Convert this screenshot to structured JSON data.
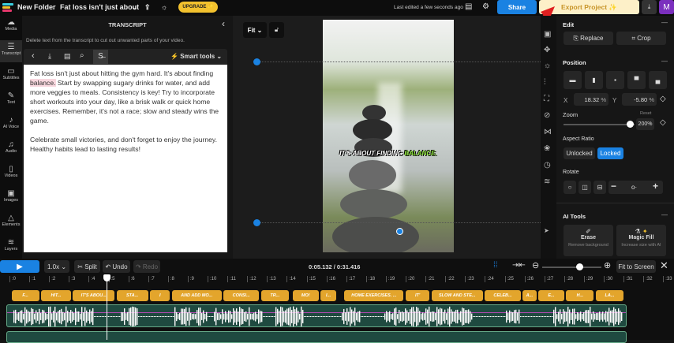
{
  "header": {
    "folder": "New Folder",
    "project": "Fat loss isn't just about",
    "upgrade": "UPGRADE ✨",
    "last_edited": "Last edited a few seconds ago",
    "share": "Share",
    "export": "Export Project ✨",
    "avatar": "M"
  },
  "nav": [
    {
      "label": "Media",
      "icon": "☁"
    },
    {
      "label": "Transcript",
      "icon": "☰"
    },
    {
      "label": "Subtitles",
      "icon": "▭"
    },
    {
      "label": "Text",
      "icon": "✎"
    },
    {
      "label": "AI Voice",
      "icon": "♪"
    },
    {
      "label": "Audio",
      "icon": "♫"
    },
    {
      "label": "Videos",
      "icon": "▯"
    },
    {
      "label": "Images",
      "icon": "▣"
    },
    {
      "label": "Elements",
      "icon": "△"
    },
    {
      "label": "Layers",
      "icon": "≋"
    }
  ],
  "transcript": {
    "title": "TRANSCRIPT",
    "hint": "Delete text from the transcript to cut out unwanted parts of your video.",
    "smart_tools": "Smart tools",
    "p1_before": "Fat loss isn't just about hitting the gym hard. It's about finding ",
    "p1_highlight": "balance.",
    "p1_after": " Start by swapping sugary drinks for water, and add more veggies to meals. Consistency is key! Try to incorporate short workouts into your day, like a brisk walk or quick home exercises. Remember, it's not a race; slow and steady wins the game.",
    "p2": "Celebrate small victories, and don't forget to enjoy the journey. Healthy habits lead to lasting results!"
  },
  "canvas": {
    "fit": "Fit",
    "caption_white": "IT'S ABOUT FINDING ",
    "caption_green": "BALANCE."
  },
  "right": {
    "edit": "Edit",
    "replace": "Replace",
    "crop": "Crop",
    "position": "Position",
    "x_label": "X",
    "x": "18.32",
    "y_label": "Y",
    "y": "-5.80",
    "pct": "%",
    "zoom": "Zoom",
    "reset": "Reset",
    "zoom_value": "200%",
    "zoom_fraction": 1.0,
    "aspect": "Aspect Ratio",
    "unlocked": "Unlocked",
    "locked": "Locked",
    "rotate": "Rotate",
    "ai_tools": "AI Tools",
    "erase": "Erase",
    "erase_sub": "Remove background",
    "magic": "Magic Fill",
    "magic_sub": "Increase size with AI"
  },
  "timeline": {
    "speed": "1.0x",
    "split": "Split",
    "undo": "Undo",
    "redo": "Redo",
    "time": "0:05.132 / 0:31.416",
    "fit": "Fit to Screen",
    "ticks": [
      ":0",
      ":1",
      ":2",
      ":3",
      ":4",
      ":5",
      ":6",
      ":7",
      ":8",
      ":9",
      ":10",
      ":11",
      ":12",
      ":13",
      ":14",
      ":15",
      ":16",
      ":17",
      ":18",
      ":19",
      ":20",
      ":21",
      ":22",
      ":23",
      ":24",
      ":25",
      ":26",
      ":27",
      ":28",
      ":29",
      ":30",
      ":31",
      ":32",
      ":33"
    ],
    "captions": [
      {
        "t": "F...",
        "s": 0.1,
        "e": 1.5
      },
      {
        "t": "HIT...",
        "s": 1.6,
        "e": 3.1
      },
      {
        "t": "IT'S ABOU...",
        "s": 3.2,
        "e": 5.3
      },
      {
        "t": "STA...",
        "s": 5.4,
        "e": 7.0
      },
      {
        "t": "I",
        "s": 7.1,
        "e": 8.1
      },
      {
        "t": "AND ADD MO...",
        "s": 8.2,
        "e": 10.7
      },
      {
        "t": "CONSI...",
        "s": 10.8,
        "e": 12.6
      },
      {
        "t": "TR...",
        "s": 12.7,
        "e": 14.1
      },
      {
        "t": "MO!",
        "s": 14.3,
        "e": 15.6
      },
      {
        "t": "I...",
        "s": 15.7,
        "e": 16.5
      },
      {
        "t": "HOME EXERCISES. ...",
        "s": 16.9,
        "e": 19.9
      },
      {
        "t": "IT'",
        "s": 20.0,
        "e": 21.2
      },
      {
        "t": "SLOW AND STE...",
        "s": 21.3,
        "e": 23.9
      },
      {
        "t": "CELEB...",
        "s": 24.0,
        "e": 25.8
      },
      {
        "t": "A...",
        "s": 25.9,
        "e": 26.6
      },
      {
        "t": "E...",
        "s": 26.7,
        "e": 28.0
      },
      {
        "t": "H...",
        "s": 28.1,
        "e": 29.5
      },
      {
        "t": "LA...",
        "s": 29.6,
        "e": 31.0
      }
    ],
    "playhead": 5.132
  }
}
